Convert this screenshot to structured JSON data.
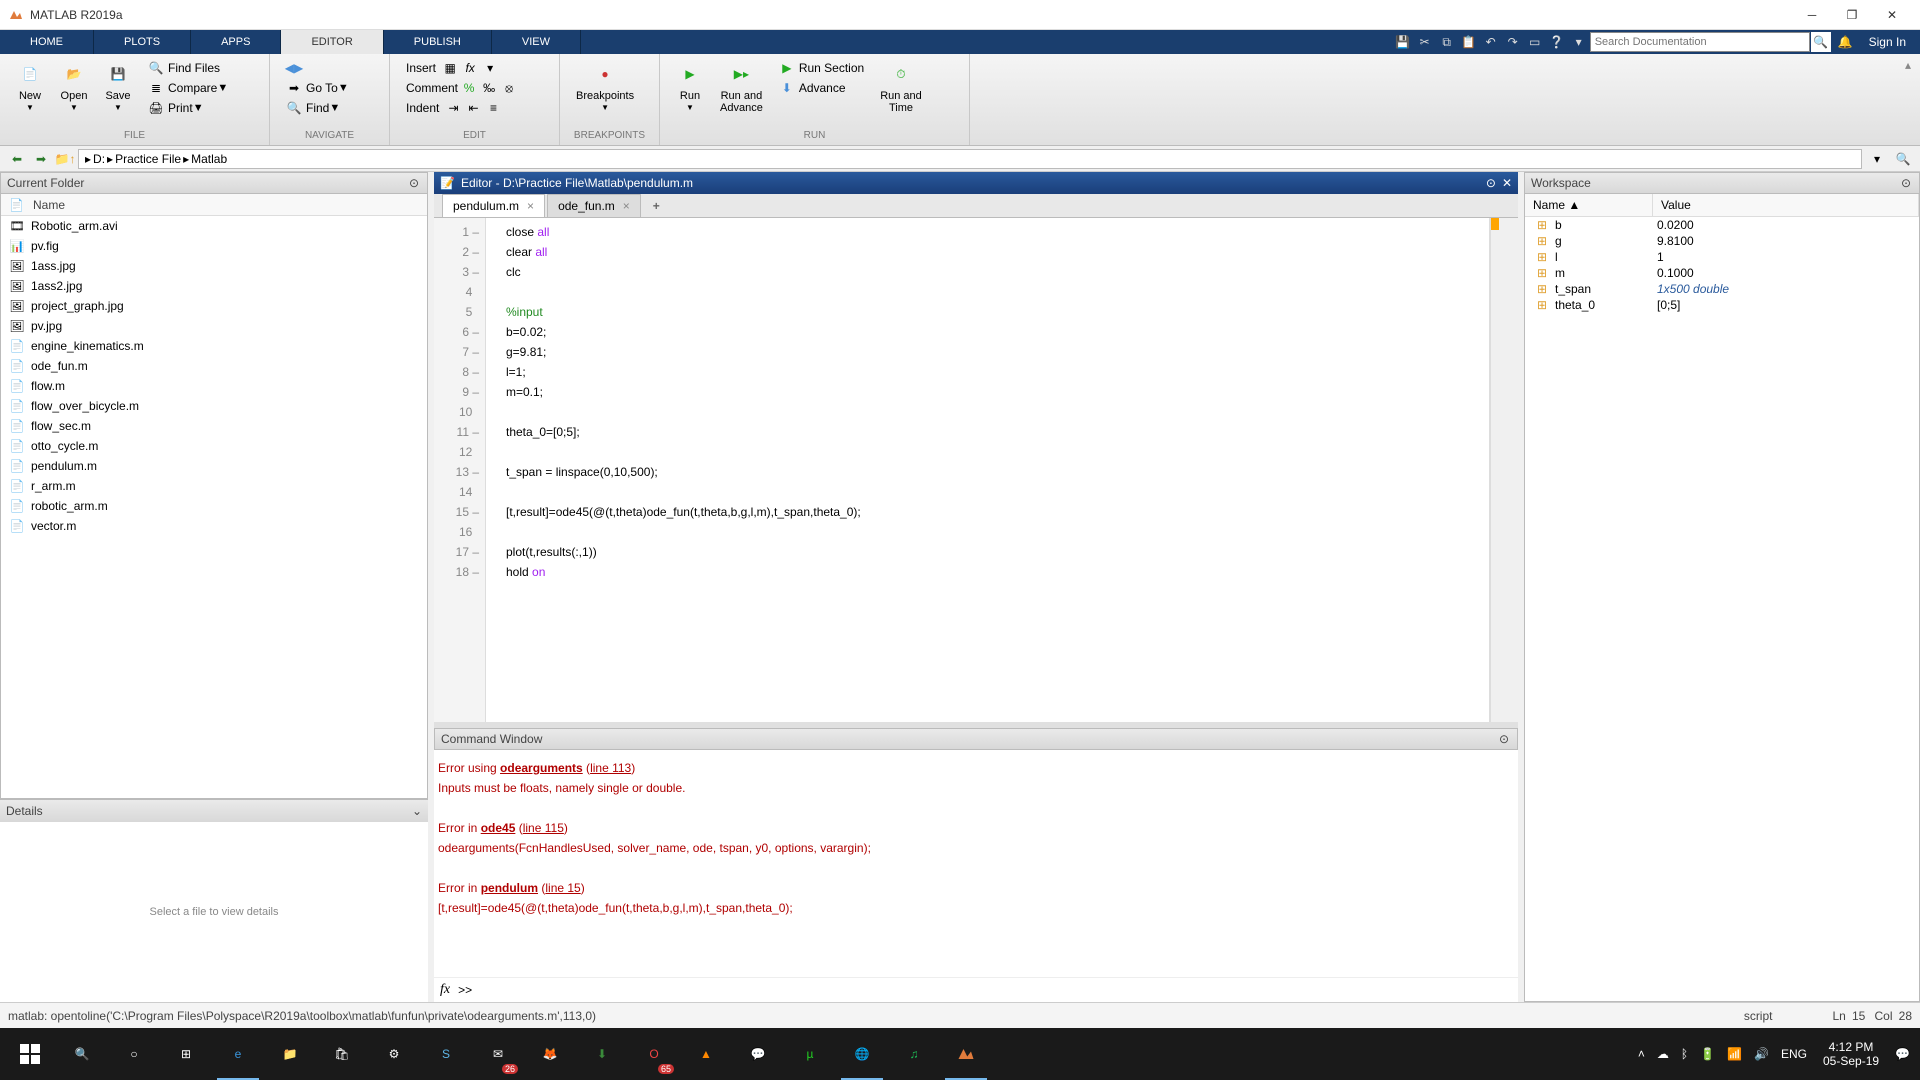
{
  "window": {
    "title": "MATLAB R2019a"
  },
  "tabs": {
    "home": "HOME",
    "plots": "PLOTS",
    "apps": "APPS",
    "editor": "EDITOR",
    "publish": "PUBLISH",
    "view": "VIEW"
  },
  "search": {
    "placeholder": "Search Documentation"
  },
  "signin": "Sign In",
  "ribbon": {
    "file": {
      "new": "New",
      "open": "Open",
      "save": "Save",
      "findfiles": "Find Files",
      "compare": "Compare",
      "print": "Print",
      "label": "FILE"
    },
    "navigate": {
      "goto": "Go To",
      "find": "Find",
      "label": "NAVIGATE"
    },
    "edit": {
      "insert": "Insert",
      "comment": "Comment",
      "indent": "Indent",
      "label": "EDIT"
    },
    "breakpoints": {
      "bp": "Breakpoints",
      "label": "BREAKPOINTS"
    },
    "run": {
      "run": "Run",
      "runadv": "Run and\nAdvance",
      "runsec": "Run Section",
      "advance": "Advance",
      "runtime": "Run and\nTime",
      "label": "RUN"
    }
  },
  "address": {
    "drive": "D:",
    "p1": "Practice File",
    "p2": "Matlab"
  },
  "currentFolder": {
    "title": "Current Folder",
    "nameCol": "Name",
    "files": [
      {
        "name": "Robotic_arm.avi",
        "type": "avi"
      },
      {
        "name": "pv.fig",
        "type": "fig"
      },
      {
        "name": "1ass.jpg",
        "type": "jpg"
      },
      {
        "name": "1ass2.jpg",
        "type": "jpg"
      },
      {
        "name": "project_graph.jpg",
        "type": "jpg"
      },
      {
        "name": "pv.jpg",
        "type": "jpg"
      },
      {
        "name": "engine_kinematics.m",
        "type": "m"
      },
      {
        "name": "ode_fun.m",
        "type": "m"
      },
      {
        "name": "flow.m",
        "type": "m"
      },
      {
        "name": "flow_over_bicycle.m",
        "type": "m"
      },
      {
        "name": "flow_sec.m",
        "type": "m"
      },
      {
        "name": "otto_cycle.m",
        "type": "m"
      },
      {
        "name": "pendulum.m",
        "type": "m"
      },
      {
        "name": "r_arm.m",
        "type": "m"
      },
      {
        "name": "robotic_arm.m",
        "type": "m"
      },
      {
        "name": "vector.m",
        "type": "m"
      }
    ]
  },
  "details": {
    "title": "Details",
    "empty": "Select a file to view details"
  },
  "editor": {
    "title": "Editor - D:\\Practice File\\Matlab\\pendulum.m",
    "tab1": "pendulum.m",
    "tab2": "ode_fun.m",
    "lines": [
      {
        "n": "1",
        "dash": true,
        "html": "close <span class='str'>all</span>"
      },
      {
        "n": "2",
        "dash": true,
        "html": "clear <span class='str'>all</span>"
      },
      {
        "n": "3",
        "dash": true,
        "html": "clc"
      },
      {
        "n": "4",
        "dash": false,
        "html": ""
      },
      {
        "n": "5",
        "dash": false,
        "html": "<span class='com'>%input</span>"
      },
      {
        "n": "6",
        "dash": true,
        "html": "b=0.02;"
      },
      {
        "n": "7",
        "dash": true,
        "html": "g=9.81;"
      },
      {
        "n": "8",
        "dash": true,
        "html": "l=1;"
      },
      {
        "n": "9",
        "dash": true,
        "html": "m=0.1;"
      },
      {
        "n": "10",
        "dash": false,
        "html": ""
      },
      {
        "n": "11",
        "dash": true,
        "html": "theta_0=[0;5];"
      },
      {
        "n": "12",
        "dash": false,
        "html": ""
      },
      {
        "n": "13",
        "dash": true,
        "html": "t_span = linspace(0,10,500);"
      },
      {
        "n": "14",
        "dash": false,
        "html": ""
      },
      {
        "n": "15",
        "dash": true,
        "html": "[t,result]=ode45(@(t,theta)ode_fun(t,theta,b,g,l,m),t_span,theta_0);"
      },
      {
        "n": "16",
        "dash": false,
        "html": ""
      },
      {
        "n": "17",
        "dash": true,
        "html": "plot(t,results(:,1))"
      },
      {
        "n": "18",
        "dash": true,
        "html": "hold <span class='str'>on</span>"
      }
    ]
  },
  "cmdwin": {
    "title": "Command Window",
    "prompt": ">>",
    "err1a": "Error using ",
    "err1b": "odearguments",
    "err1c": " (",
    "err1d": "line 113",
    "err1e": ")",
    "err2": "Inputs must be floats, namely single or double.",
    "err3a": "Error in ",
    "err3b": "ode45",
    "err3c": " (",
    "err3d": "line 115",
    "err3e": ")",
    "err4": "  odearguments(FcnHandlesUsed, solver_name, ode, tspan, y0, options, varargin);",
    "err5a": "Error in ",
    "err5b": "pendulum",
    "err5c": " (",
    "err5d": "line 15",
    "err5e": ")",
    "err6": "[t,result]=ode45(@(t,theta)ode_fun(t,theta,b,g,l,m),t_span,theta_0);"
  },
  "workspace": {
    "title": "Workspace",
    "nameCol": "Name ▲",
    "valueCol": "Value",
    "vars": [
      {
        "name": "b",
        "value": "0.0200"
      },
      {
        "name": "g",
        "value": "9.8100"
      },
      {
        "name": "l",
        "value": "1"
      },
      {
        "name": "m",
        "value": "0.1000"
      },
      {
        "name": "t_span",
        "value": "1x500 double",
        "italic": true
      },
      {
        "name": "theta_0",
        "value": "[0;5]"
      }
    ]
  },
  "status": {
    "left": "matlab: opentoline('C:\\Program Files\\Polyspace\\R2019a\\toolbox\\matlab\\funfun\\private\\odearguments.m',113,0)",
    "script": "script",
    "ln": "Ln",
    "lnv": "15",
    "col": "Col",
    "colv": "28"
  },
  "tray": {
    "lang": "ENG",
    "time": "4:12 PM",
    "date": "05-Sep-19",
    "mail_badge": "26",
    "opera_badge": "65"
  }
}
